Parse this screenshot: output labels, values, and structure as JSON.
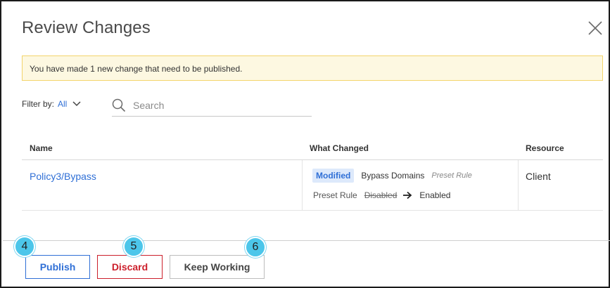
{
  "dialog": {
    "title": "Review Changes",
    "close_icon": "close-icon"
  },
  "banner": {
    "message": "You have made 1 new change that need to be published."
  },
  "filter": {
    "label": "Filter by:",
    "value": "All",
    "icon": "chevron-down-icon"
  },
  "search": {
    "placeholder": "Search",
    "value": "",
    "icon": "search-icon"
  },
  "table": {
    "headers": [
      "Name",
      "What Changed",
      "Resource"
    ],
    "rows": [
      {
        "name": "Policy3/Bypass",
        "badge": "Modified",
        "field": "Bypass Domains",
        "field_type": "Preset Rule",
        "detail_label": "Preset Rule",
        "old_value": "Disabled",
        "new_value": "Enabled",
        "resource": "Client"
      }
    ]
  },
  "buttons": {
    "publish": "Publish",
    "discard": "Discard",
    "keep_working": "Keep Working"
  },
  "step_markers": [
    "4",
    "5",
    "6"
  ],
  "colors": {
    "accent": "#2f6fd6",
    "danger": "#cc1f2b",
    "banner_bg": "#fdf8e1",
    "banner_border": "#f3d46b",
    "step_marker": "#4cc6ea"
  }
}
